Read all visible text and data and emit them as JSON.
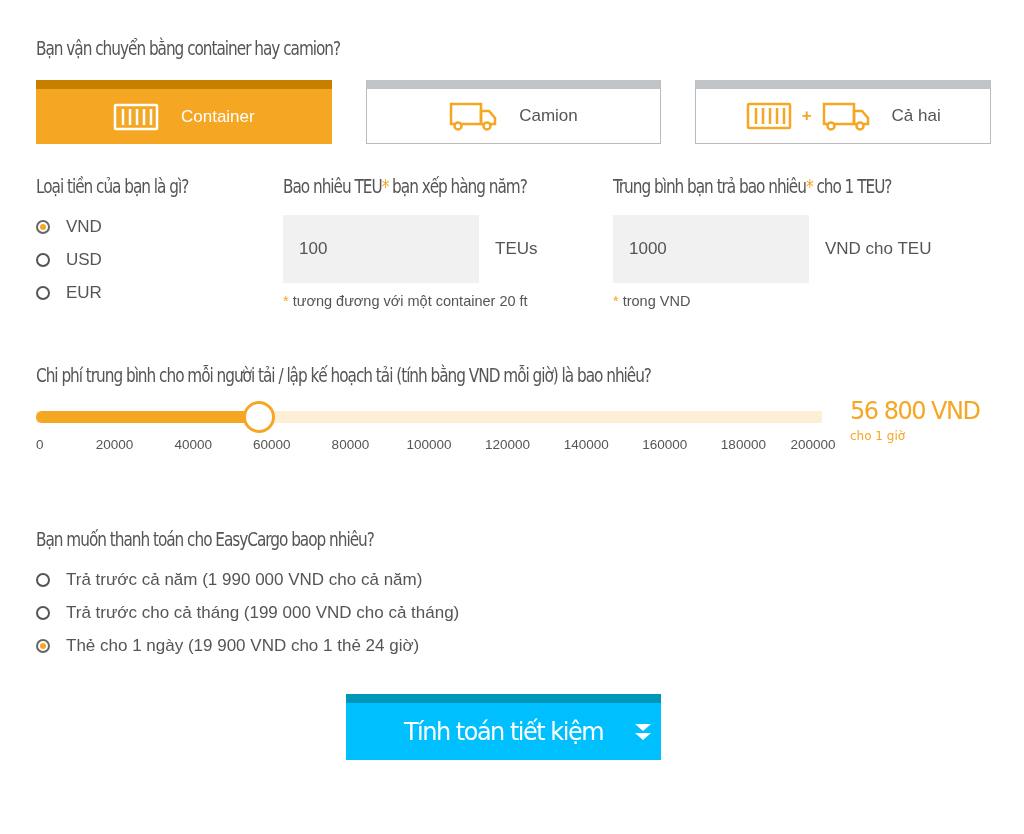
{
  "transport": {
    "question": "Bạn vận chuyển bằng container hay camion?",
    "options": [
      {
        "kind": "container",
        "label": "Container",
        "selected": true
      },
      {
        "kind": "truck",
        "label": "Camion",
        "selected": false
      },
      {
        "kind": "both",
        "label": "Cả hai",
        "plus": "+",
        "selected": false
      }
    ]
  },
  "currency": {
    "question": "Loại tiền của bạn là gì?",
    "options": [
      {
        "label": "VND",
        "selected": true
      },
      {
        "label": "USD",
        "selected": false
      },
      {
        "label": "EUR",
        "selected": false
      }
    ]
  },
  "teu": {
    "question": "Bao nhiêu TEU",
    "star": "*",
    "question_rest": " bạn xếp hàng năm?",
    "value": "100",
    "unit": "TEUs",
    "note_star": "*",
    "note": " tương đương với một container 20 ft"
  },
  "price": {
    "question": "Trung bình bạn trả bao nhiêu",
    "star": "*",
    "question_rest": " cho 1 TEU?",
    "value": "1000",
    "unit": "VND cho TEU",
    "note_star": "*",
    "note": " trong VND"
  },
  "hourly": {
    "question": "Chi phí trung bình cho mỗi người tải / lập kế hoạch tải (tính bằng VND mỗi giờ) là bao nhiêu?",
    "level": 0.284,
    "ticks": [
      "0",
      "20000",
      "40000",
      "60000",
      "80000",
      "100000",
      "120000",
      "140000",
      "160000",
      "180000",
      "200000"
    ],
    "reading": "56 800 VND",
    "reading_unit": "cho 1 giờ"
  },
  "payment": {
    "question": "Bạn muốn thanh toán cho EasyCargo baop nhiêu?",
    "options": [
      {
        "label": "Trả trước cả năm (1 990 000 VND cho cả năm)",
        "selected": false
      },
      {
        "label": "Trả trước cho cả tháng (199 000 VND cho cả tháng)",
        "selected": false
      },
      {
        "label": "Thẻ cho 1 ngày (19 900 VND cho 1 thẻ 24 giờ)",
        "selected": true
      }
    ]
  },
  "calculate_button": {
    "label": "Tính toán tiết kiệm"
  }
}
